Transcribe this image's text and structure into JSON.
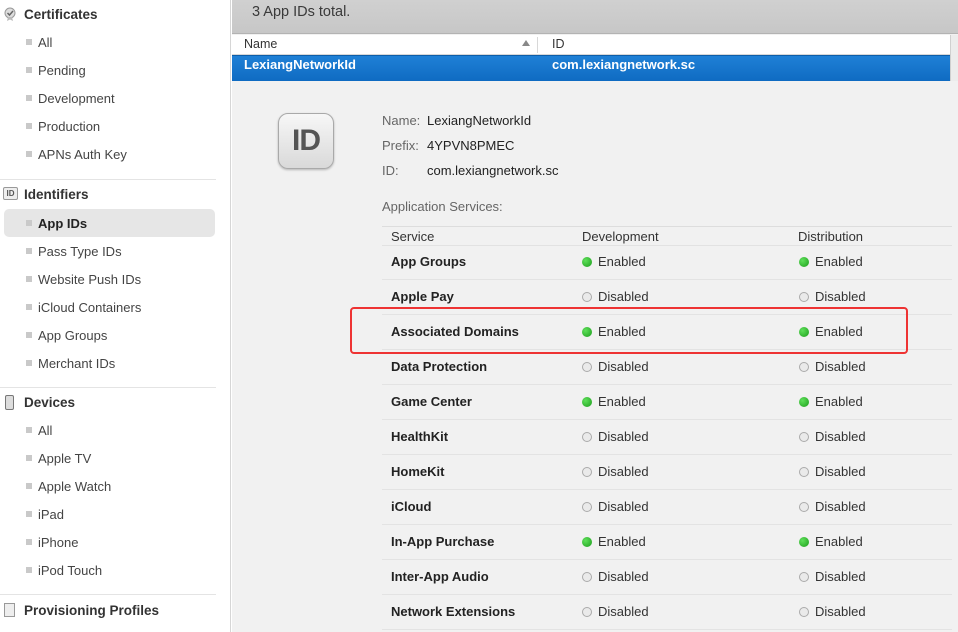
{
  "sidebar": {
    "certificates": {
      "title": "Certificates",
      "items": [
        "All",
        "Pending",
        "Development",
        "Production",
        "APNs Auth Key"
      ]
    },
    "identifiers": {
      "title": "Identifiers",
      "icon_text": "ID",
      "items": [
        "App IDs",
        "Pass Type IDs",
        "Website Push IDs",
        "iCloud Containers",
        "App Groups",
        "Merchant IDs"
      ],
      "active": "App IDs"
    },
    "devices": {
      "title": "Devices",
      "items": [
        "All",
        "Apple TV",
        "Apple Watch",
        "iPad",
        "iPhone",
        "iPod Touch"
      ]
    },
    "profiles": {
      "title": "Provisioning Profiles"
    }
  },
  "main": {
    "total_text": "3  App IDs total.",
    "columns": {
      "name": "Name",
      "id": "ID"
    },
    "selected_row": {
      "name": "LexiangNetworkId",
      "id": "com.lexiangnetwork.sc"
    },
    "detail": {
      "icon_text": "ID",
      "name_label": "Name:",
      "name_value": "LexiangNetworkId",
      "prefix_label": "Prefix:",
      "prefix_value": "4YPVN8PMEC",
      "id_label": "ID:",
      "id_value": "com.lexiangnetwork.sc",
      "services_label": "Application Services:",
      "services_columns": {
        "service": "Service",
        "dev": "Development",
        "dist": "Distribution"
      },
      "services": [
        {
          "name": "App Groups",
          "dev": "Enabled",
          "dist": "Enabled"
        },
        {
          "name": "Apple Pay",
          "dev": "Disabled",
          "dist": "Disabled"
        },
        {
          "name": "Associated Domains",
          "dev": "Enabled",
          "dist": "Enabled"
        },
        {
          "name": "Data Protection",
          "dev": "Disabled",
          "dist": "Disabled"
        },
        {
          "name": "Game Center",
          "dev": "Enabled",
          "dist": "Enabled"
        },
        {
          "name": "HealthKit",
          "dev": "Disabled",
          "dist": "Disabled"
        },
        {
          "name": "HomeKit",
          "dev": "Disabled",
          "dist": "Disabled"
        },
        {
          "name": "iCloud",
          "dev": "Disabled",
          "dist": "Disabled"
        },
        {
          "name": "In-App Purchase",
          "dev": "Enabled",
          "dist": "Enabled"
        },
        {
          "name": "Inter-App Audio",
          "dev": "Disabled",
          "dist": "Disabled"
        },
        {
          "name": "Network Extensions",
          "dev": "Disabled",
          "dist": "Disabled"
        }
      ]
    }
  },
  "colors": {
    "selection": "#1576cc",
    "enabled": "#2fbf2b",
    "highlight": "#e33333"
  }
}
